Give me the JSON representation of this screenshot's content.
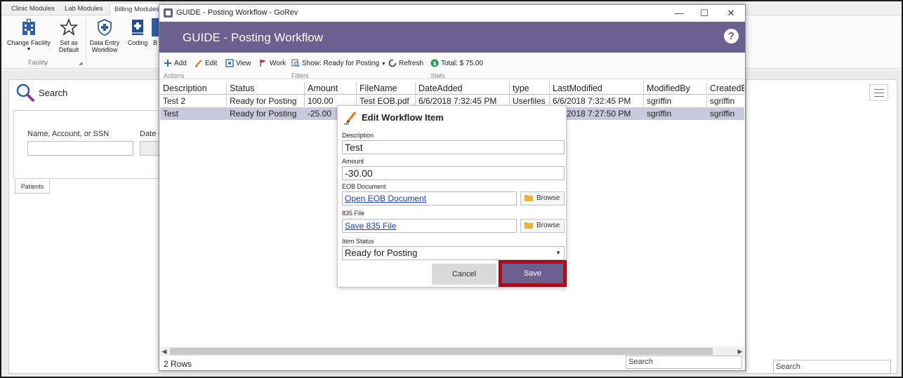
{
  "ribbon": {
    "tabs": [
      "Clinic Modules",
      "Lab Modules",
      "Billing Modules"
    ],
    "buttons": {
      "change_facility": "Change Facility",
      "set_default_line1": "Set as",
      "set_default_line2": "Default",
      "data_entry_line1": "Data Entry",
      "data_entry_line2": "Workflow",
      "coding": "Coding",
      "partial": "B"
    },
    "group_label": "Facility"
  },
  "search_pane": {
    "title": "Search",
    "name_label": "Name, Account, or SSN",
    "date_label": "Date o",
    "patients_tab": "Patients"
  },
  "bg_search": {
    "placeholder": "Search"
  },
  "workflow": {
    "window_title": "GUIDE - Posting Workflow - GoRev",
    "header_title": "GUIDE - Posting Workflow",
    "help": "?",
    "toolbar": {
      "add": "Add",
      "edit": "Edit",
      "view": "View",
      "work": "Work",
      "show": "Show: Ready for Posting",
      "refresh": "Refresh",
      "total": "Total: $ 75.00",
      "group_actions": "Actions",
      "group_filters": "Filters",
      "group_stats": "Stats"
    },
    "columns": [
      "Description",
      "Status",
      "Amount",
      "FileName",
      "DateAdded",
      "type",
      "LastModified",
      "ModifiedBy",
      "CreatedB"
    ],
    "rows": [
      [
        "Test 2",
        "Ready for Posting",
        "100.00",
        "Test EOB.pdf",
        "6/6/2018 7:32:45 PM",
        "Userfiles",
        "6/6/2018 7:32:45 PM",
        "sgriffin",
        "sgriffin"
      ],
      [
        "Test",
        "Ready for Posting",
        "-25.00",
        "",
        "",
        "",
        "2018 7:27:50 PM",
        "sgriffin",
        "sgriffin"
      ]
    ],
    "row_count": "2 Rows",
    "search_placeholder": "Search"
  },
  "dialog": {
    "title": "Edit Workflow Item",
    "description_label": "Description",
    "description_value": "Test",
    "amount_label": "Amount",
    "amount_value": "-30.00",
    "eob_label": "EOB Document",
    "eob_link": "Open EOB Document",
    "file835_label": "835 File",
    "file835_link": "Save 835 File",
    "browse": "Browse",
    "status_label": "Item Status",
    "status_value": "Ready for Posting",
    "cancel": "Cancel",
    "save": "Save"
  },
  "colors": {
    "header_purple": "#6a6191",
    "selected_row": "#c9c9de",
    "highlight_red": "#b00b1e",
    "link_blue": "#1a3fbf"
  }
}
